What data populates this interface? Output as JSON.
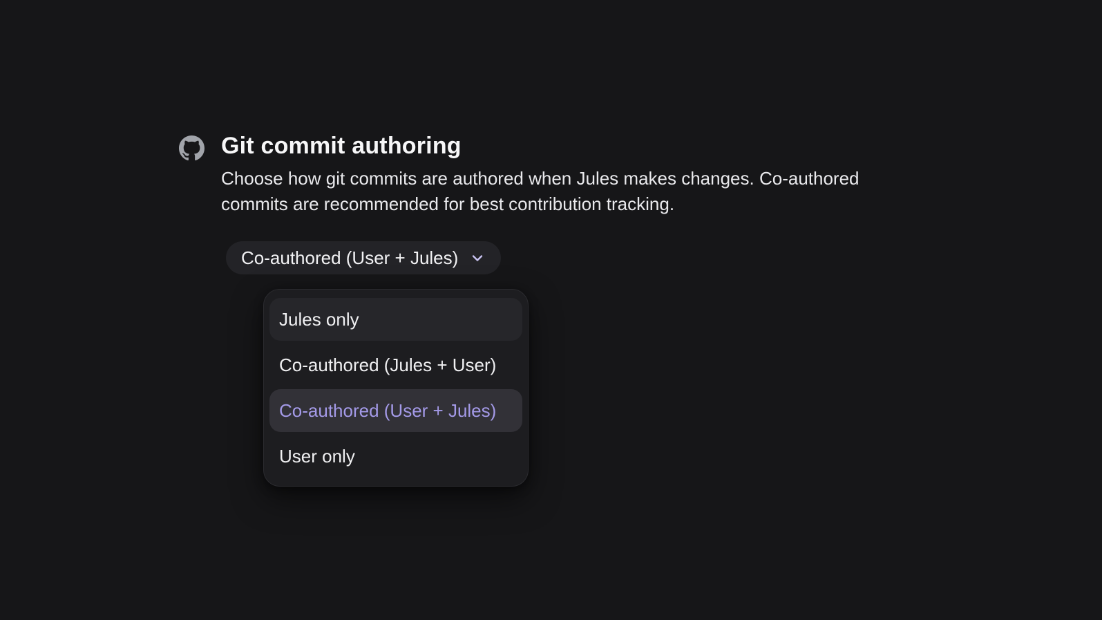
{
  "page": {
    "background_color": "#161618",
    "accent_color": "#a49ae8"
  },
  "section": {
    "icon": "github-icon",
    "title": "Git commit authoring",
    "description_line1": "Choose how git commits are authored when Jules makes changes. Co-authored",
    "description_line2": "commits are recommended for best contribution tracking."
  },
  "select": {
    "value": "Co-authored (User + Jules)",
    "chevron_icon": "chevron-down-icon",
    "chevron_color": "#c9c3f1",
    "background_color": "#232327"
  },
  "dropdown": {
    "background_color": "#1d1d20",
    "hover_background_color": "#26262a",
    "selected_background_color": "#323137",
    "selected_text_color": "#a49ae8",
    "options": [
      {
        "label": "Jules only",
        "state": "hovered"
      },
      {
        "label": "Co-authored (Jules + User)",
        "state": "normal"
      },
      {
        "label": "Co-authored (User + Jules)",
        "state": "selected"
      },
      {
        "label": "User only",
        "state": "normal"
      }
    ]
  }
}
